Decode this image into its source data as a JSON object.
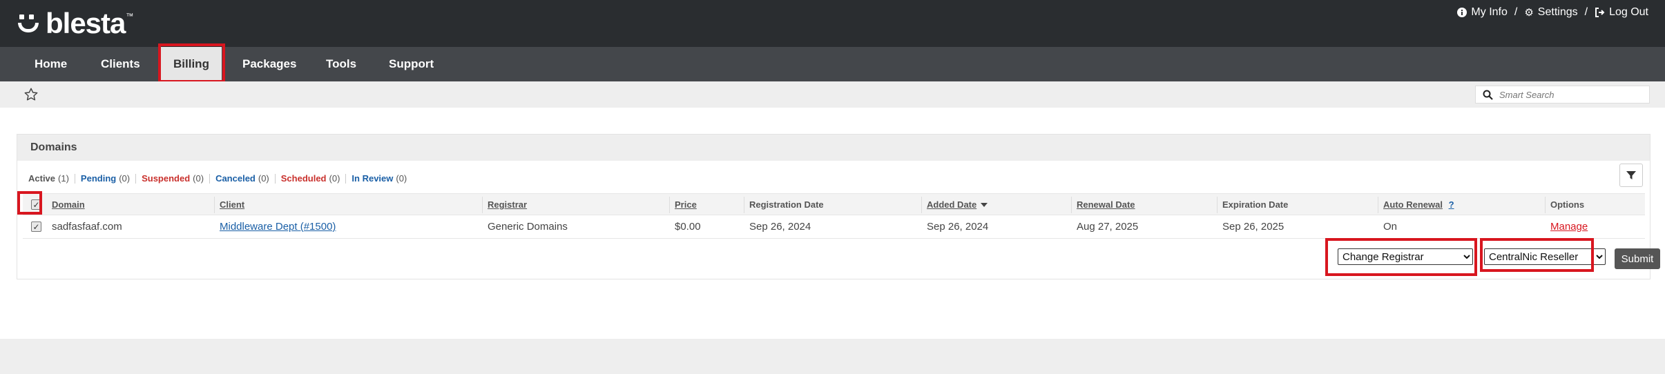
{
  "header": {
    "logo_text": "blesta",
    "logo_tm": "™",
    "links": [
      {
        "label": "My Info",
        "icon": "info-circle-icon"
      },
      {
        "label": "Settings",
        "icon": "gear-icon"
      },
      {
        "label": "Log Out",
        "icon": "logout-icon"
      }
    ],
    "separator": "/"
  },
  "nav": {
    "items": [
      {
        "label": "Home"
      },
      {
        "label": "Clients"
      },
      {
        "label": "Billing",
        "active": true
      },
      {
        "label": "Packages"
      },
      {
        "label": "Tools"
      },
      {
        "label": "Support"
      }
    ]
  },
  "subbar": {
    "favorite_icon": "star-icon",
    "search_placeholder": "Smart Search"
  },
  "panel": {
    "title": "Domains",
    "status_tabs": [
      {
        "label": "Active",
        "count": "(1)",
        "color": "#555555"
      },
      {
        "label": "Pending",
        "count": "(0)",
        "color": "#1a5fa6"
      },
      {
        "label": "Suspended",
        "count": "(0)",
        "color": "#c9302c"
      },
      {
        "label": "Canceled",
        "count": "(0)",
        "color": "#1a5fa6"
      },
      {
        "label": "Scheduled",
        "count": "(0)",
        "color": "#c9302c"
      },
      {
        "label": "In Review",
        "count": "(0)",
        "color": "#1a5fa6"
      }
    ],
    "columns": {
      "domain": "Domain",
      "client": "Client",
      "registrar": "Registrar",
      "price": "Price",
      "registration_date": "Registration Date",
      "added_date": "Added Date",
      "renewal_date": "Renewal Date",
      "expiration_date": "Expiration Date",
      "auto_renewal": "Auto Renewal",
      "auto_renewal_help": "?",
      "options": "Options"
    },
    "rows": [
      {
        "domain": "sadfasfaaf.com",
        "client": "Middleware Dept (#1500)",
        "registrar": "Generic Domains",
        "price": "$0.00",
        "registration_date": "Sep 26, 2024",
        "added_date": "Sep 26, 2024",
        "renewal_date": "Aug 27, 2025",
        "expiration_date": "Sep 26, 2025",
        "auto_renewal": "On",
        "option": "Manage",
        "checked": true
      }
    ],
    "action_select": "Change Registrar",
    "registrar_select": "CentralNic Reseller",
    "submit_label": "Submit"
  },
  "highlight_color": "#d8161f"
}
